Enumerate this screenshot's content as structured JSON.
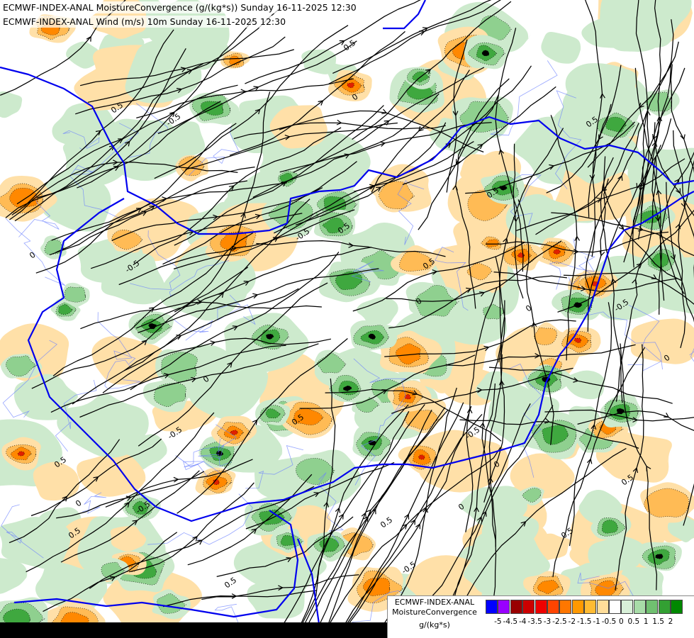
{
  "header": {
    "line1": "ECMWF-INDEX-ANAL MoistureConvergence (g/(kg*s)) Sunday 16-11-2025 12:30",
    "line2": "ECMWF-INDEX-ANAL Wind (m/s) 10m Sunday 16-11-2025 12:30"
  },
  "legend": {
    "title_line1": "ECMWF-INDEX-ANAL",
    "title_line2": "MoistureConvergence",
    "unit": "g/(kg*s)",
    "colors": [
      "#0000ff",
      "#9900ff",
      "#990000",
      "#cc0000",
      "#ee0000",
      "#ff4400",
      "#ff7700",
      "#ff9900",
      "#ffbb33",
      "#ffdd99",
      "#ffffff",
      "#d8f0d8",
      "#a8dca8",
      "#70c070",
      "#33a033",
      "#008800"
    ],
    "ticks": [
      "-5",
      "-4.5",
      "-4",
      "-3.5",
      "-3",
      "-2.5",
      "-2",
      "-1.5",
      "-1",
      "-0.5",
      "0",
      "0.5",
      "1",
      "1.5",
      "2"
    ]
  },
  "contour_labels": [
    "0.5",
    "-0.5",
    "0.5",
    "0",
    "0",
    "-0.5",
    "0.5",
    "-0.5",
    "0",
    "0.5",
    "0.5",
    "-0.5",
    "0",
    "0.5",
    "0.5",
    "0",
    "-0.5",
    "0.5",
    "0",
    "-0.5",
    "0.5",
    "0.5",
    "0",
    "0.5",
    "-0.5",
    "0",
    "0.5",
    "0",
    "-0.5",
    "0.5"
  ],
  "fill_colors": {
    "background": "#ffffff",
    "conv_light": "#cdeacd",
    "conv_mid": "#8fd08f",
    "conv_strong": "#3fa83f",
    "conv_max": "#000000",
    "div_light": "#ffe0a8",
    "div_mid": "#ffbb55",
    "div_strong": "#ff8800",
    "div_max": "#e02000",
    "border": "#0000ee",
    "river": "#6a7fff",
    "streamline": "#000000"
  }
}
